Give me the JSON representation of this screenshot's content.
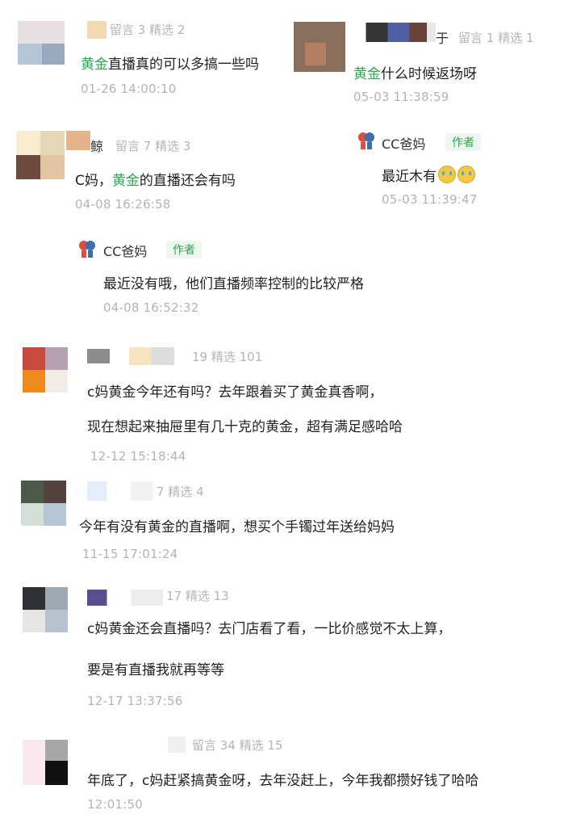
{
  "comments": [
    {
      "meta": "留言 3 精选 2",
      "text": [
        "直播真的可以多搞一些吗"
      ],
      "text_prefix": "黄金",
      "time": "01-26 14:00:10"
    },
    {
      "name_tail": "于",
      "meta": "留言 1 精选 1",
      "text_suffix": "什么时候返场呀",
      "text_prefix": "黄金",
      "time": "05-03 11:38:59",
      "reply": {
        "name": "CC爸妈",
        "badge": "作者",
        "text": "最近木有",
        "time": "05-03 11:39:47"
      }
    },
    {
      "name_tail": "鲸",
      "meta": "留言 7 精选 3",
      "text_a": "C妈，",
      "text_gold": "黄金",
      "text_b": "的直播还会有吗",
      "time": "04-08 16:26:58",
      "reply": {
        "name": "CC爸妈",
        "badge": "作者",
        "text": "最近没有哦，他们直播频率控制的比较严格",
        "time": "04-08 16:52:32"
      }
    },
    {
      "meta": "19 精选 101",
      "line1": "c妈黄金今年还有吗？去年跟着买了黄金真香啊，",
      "line2": "现在想起来抽屉里有几十克的黄金，超有满足感哈哈",
      "time": "12-12 15:18:44"
    },
    {
      "meta": "7 精选 4",
      "line1": "今年有没有黄金的直播啊，想买个手镯过年送给妈妈",
      "time": "11-15 17:01:24"
    },
    {
      "meta": "17 精选 13",
      "line1": "c妈黄金还会直播吗？去门店看了看，一比价感觉不太上算，",
      "line2": "要是有直播我就再等等",
      "time": "12-17 13:37:56"
    },
    {
      "meta": "留言 34 精选 15",
      "line1": "年底了，c妈赶紧搞黄金呀，去年没赶上，今年我都攒好钱了哈哈",
      "time": "12:01:50"
    }
  ],
  "colors": {
    "accent": "#2ea54f",
    "meta": "#b5b5b5"
  }
}
